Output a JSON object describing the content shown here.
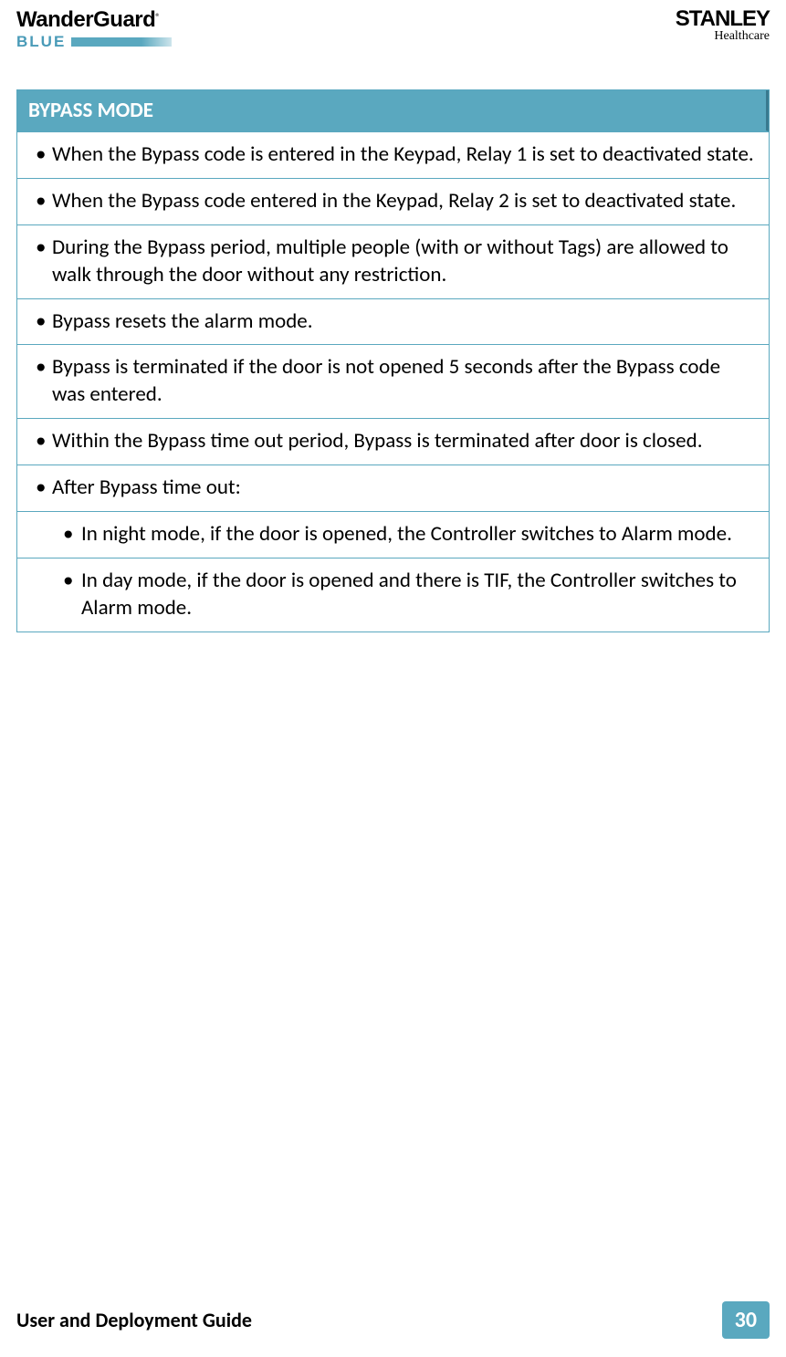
{
  "header": {
    "brand_main": "WanderGuard",
    "brand_reg": "®",
    "brand_sub": "BLUE",
    "company_main": "STANLEY",
    "company_sub": "Healthcare"
  },
  "table": {
    "title": "BYPASS MODE",
    "rows": [
      {
        "text": "When the Bypass code is entered in the Keypad, Relay 1 is set to deactivated state.",
        "sub": false
      },
      {
        "text": "When the Bypass code entered in the Keypad, Relay 2 is set to deactivated state.",
        "sub": false
      },
      {
        "text": "During the Bypass period, multiple people (with or without Tags) are allowed to walk through the door without any restriction.",
        "sub": false
      },
      {
        "text": "Bypass resets the alarm mode.",
        "sub": false
      },
      {
        "text": "Bypass is terminated if the door is not opened 5 seconds after the Bypass code was entered.",
        "sub": false
      },
      {
        "text": "Within the Bypass time out period, Bypass is terminated after door is closed.",
        "sub": false
      },
      {
        "text": "After Bypass time out:",
        "sub": false
      },
      {
        "text": "In night mode, if the door is opened, the Controller switches to Alarm mode.",
        "sub": true
      },
      {
        "text": "In day mode, if the door is opened and there is TIF, the Controller switches to Alarm mode.",
        "sub": true
      }
    ]
  },
  "footer": {
    "guide_text": "User and Deployment Guide",
    "page_number": "30"
  }
}
